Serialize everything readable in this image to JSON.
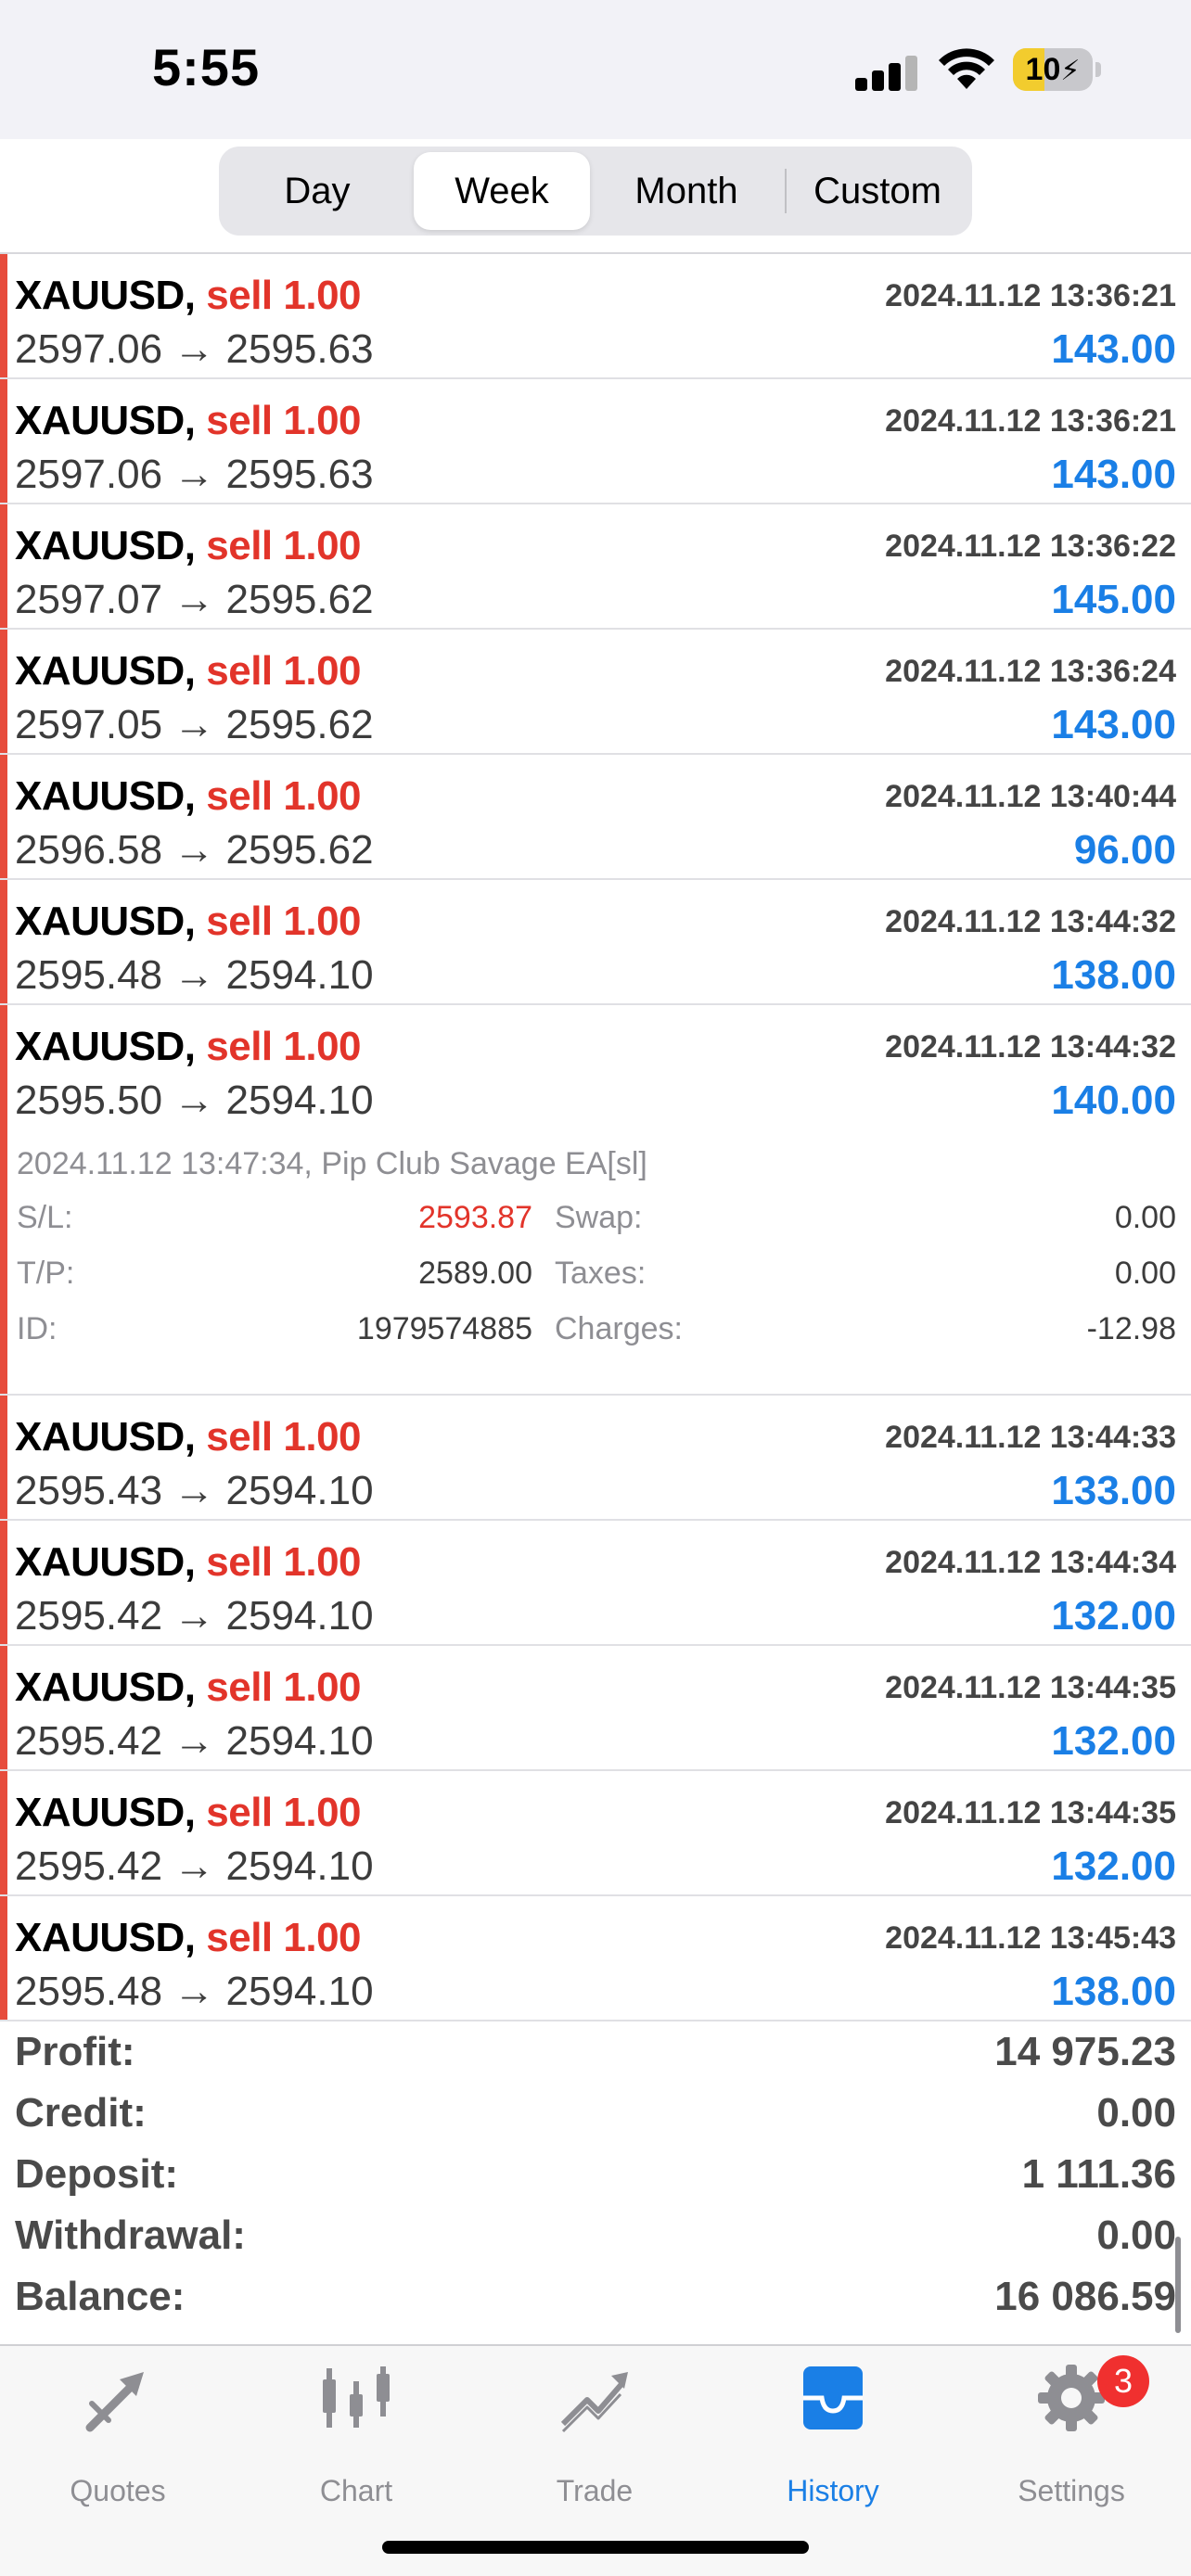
{
  "status_bar": {
    "time": "5:55",
    "battery": "10",
    "battery_level": 0.1
  },
  "tabs": [
    "Day",
    "Week",
    "Month",
    "Custom"
  ],
  "active_tab": "Week",
  "trades": [
    {
      "symbol": "XAUUSD,",
      "side": "sell 1.00",
      "prices": "2597.06 → 2595.63",
      "time": "2024.11.12 13:36:21",
      "profit": "143.00"
    },
    {
      "symbol": "XAUUSD,",
      "side": "sell 1.00",
      "prices": "2597.06 → 2595.63",
      "time": "2024.11.12 13:36:21",
      "profit": "143.00"
    },
    {
      "symbol": "XAUUSD,",
      "side": "sell 1.00",
      "prices": "2597.07 → 2595.62",
      "time": "2024.11.12 13:36:22",
      "profit": "145.00"
    },
    {
      "symbol": "XAUUSD,",
      "side": "sell 1.00",
      "prices": "2597.05 → 2595.62",
      "time": "2024.11.12 13:36:24",
      "profit": "143.00"
    },
    {
      "symbol": "XAUUSD,",
      "side": "sell 1.00",
      "prices": "2596.58 → 2595.62",
      "time": "2024.11.12 13:40:44",
      "profit": "96.00"
    },
    {
      "symbol": "XAUUSD,",
      "side": "sell 1.00",
      "prices": "2595.48 → 2594.10",
      "time": "2024.11.12 13:44:32",
      "profit": "138.00"
    },
    {
      "symbol": "XAUUSD,",
      "side": "sell 1.00",
      "prices": "2595.50 → 2594.10",
      "time": "2024.11.12 13:44:32",
      "profit": "140.00",
      "detail": {
        "header": "2024.11.12 13:47:34, Pip Club Savage EA[sl]",
        "sl_label": "S/L:",
        "sl": "2593.87",
        "tp_label": "T/P:",
        "tp": "2589.00",
        "id_label": "ID:",
        "id": "1979574885",
        "swap_label": "Swap:",
        "swap": "0.00",
        "taxes_label": "Taxes:",
        "taxes": "0.00",
        "charges_label": "Charges:",
        "charges": "-12.98"
      }
    },
    {
      "symbol": "XAUUSD,",
      "side": "sell 1.00",
      "prices": "2595.43 → 2594.10",
      "time": "2024.11.12 13:44:33",
      "profit": "133.00"
    },
    {
      "symbol": "XAUUSD,",
      "side": "sell 1.00",
      "prices": "2595.42 → 2594.10",
      "time": "2024.11.12 13:44:34",
      "profit": "132.00"
    },
    {
      "symbol": "XAUUSD,",
      "side": "sell 1.00",
      "prices": "2595.42 → 2594.10",
      "time": "2024.11.12 13:44:35",
      "profit": "132.00"
    },
    {
      "symbol": "XAUUSD,",
      "side": "sell 1.00",
      "prices": "2595.42 → 2594.10",
      "time": "2024.11.12 13:44:35",
      "profit": "132.00"
    },
    {
      "symbol": "XAUUSD,",
      "side": "sell 1.00",
      "prices": "2595.48 → 2594.10",
      "time": "2024.11.12 13:45:43",
      "profit": "138.00"
    }
  ],
  "summary": [
    {
      "label": "Profit:",
      "value": "14 975.23"
    },
    {
      "label": "Credit:",
      "value": "0.00"
    },
    {
      "label": "Deposit:",
      "value": "1 111.36"
    },
    {
      "label": "Withdrawal:",
      "value": "0.00"
    },
    {
      "label": "Balance:",
      "value": "16 086.59"
    }
  ],
  "nav": [
    {
      "label": "Quotes",
      "icon": "quotes-icon"
    },
    {
      "label": "Chart",
      "icon": "chart-icon"
    },
    {
      "label": "Trade",
      "icon": "trade-icon"
    },
    {
      "label": "History",
      "icon": "history-icon"
    },
    {
      "label": "Settings",
      "icon": "settings-icon",
      "badge": "3"
    }
  ],
  "active_nav": "History",
  "colors": {
    "sell": "#e2342a",
    "profit": "#1a7fe6",
    "accent": "#e74c3c",
    "active": "#1a7fe6",
    "badge": "#f0302f"
  }
}
